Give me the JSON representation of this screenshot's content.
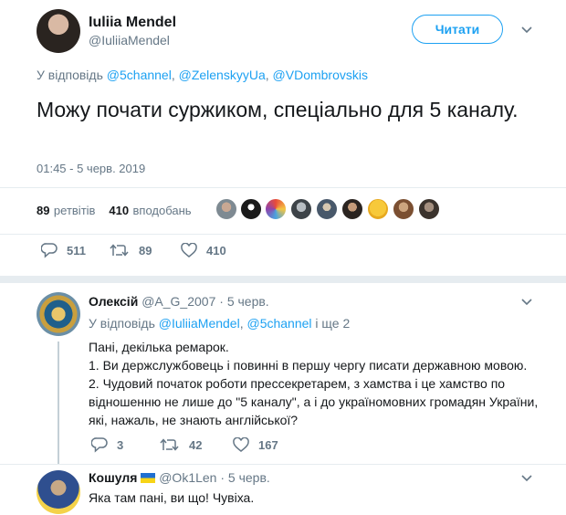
{
  "tweet": {
    "author_name": "Iuliia Mendel",
    "author_handle": "@IuliiaMendel",
    "follow_label": "Читати",
    "reply_prefix": "У відповідь",
    "reply_to": [
      "@5channel",
      "@ZelenskyyUa",
      "@VDombrovskis"
    ],
    "text": "Можу почати суржиком, спеціально для 5 каналу.",
    "timestamp": "01:45 - 5 черв. 2019",
    "retweets_count": "89",
    "retweets_label": "ретвітів",
    "likes_count": "410",
    "likes_label": "вподобань",
    "actions": {
      "replies": "511",
      "retweets": "89",
      "likes": "410"
    }
  },
  "replies": [
    {
      "author_name": "Олексій",
      "author_handle": "@A_G_2007",
      "date": "5 черв.",
      "reply_prefix": "У відповідь",
      "reply_to_1": "@IuliiaMendel",
      "reply_to_2": "@5channel",
      "reply_more": "і ще 2",
      "lines": [
        "Пані, декілька ремарок.",
        "1. Ви держслужбовець і повинні в першу чергу писати державною мовою.",
        "2. Чудовий початок роботи прессекретарем, з хамства і це хамство по",
        "відношенню не лише до \"5 каналу\", а і до україномовних громадян України,",
        "які, нажаль, не знають англійської?"
      ],
      "actions": {
        "replies": "3",
        "retweets": "42",
        "likes": "167"
      }
    },
    {
      "author_name": "Кошуля",
      "author_handle": "@Ok1Len",
      "date": "5 черв.",
      "text": "Яка там пані, ви що! Чувіха."
    }
  ],
  "colors": {
    "accent": "#1da1f2",
    "muted": "#657786",
    "divider": "#e6ecf0"
  }
}
